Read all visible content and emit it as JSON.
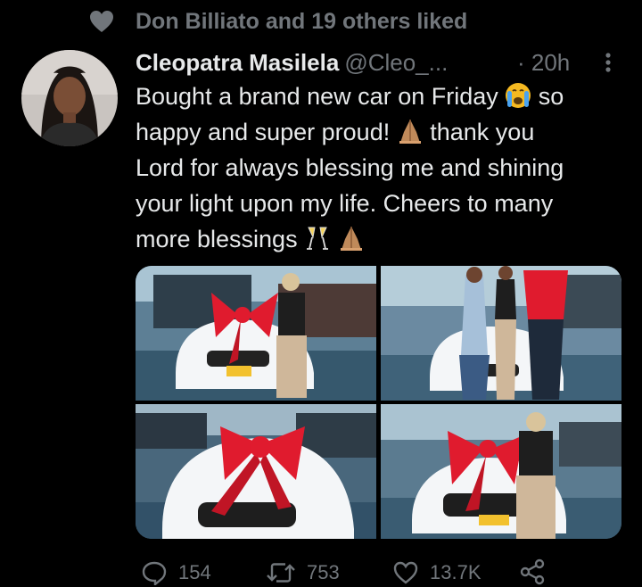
{
  "social_context": {
    "text": "Don Billiato and 19 others liked"
  },
  "tweet": {
    "display_name": "Cleopatra Masilela",
    "handle": "@Cleo_...",
    "time": "· 20h",
    "text_lines": [
      "Bought a brand new car on Friday",
      "so",
      "happy and super proud!",
      "thank you",
      "Lord for always blessing me and shining",
      "your light upon my life. Cheers to many",
      "more blessings"
    ]
  },
  "icons": [
    "heart-icon",
    "more-icon",
    "crying-face-emoji",
    "folded-hands-emoji",
    "champagne-glasses-emoji",
    "reply-icon",
    "retweet-icon",
    "like-icon",
    "share-icon"
  ],
  "actions": {
    "replies": "154",
    "retweets": "753",
    "likes": "13.7K"
  },
  "colors": {
    "background": "#000000",
    "text": "#e7e9ea",
    "muted": "#71767b",
    "ribbon": "#e01b2e",
    "car": "#f4f6f8"
  }
}
